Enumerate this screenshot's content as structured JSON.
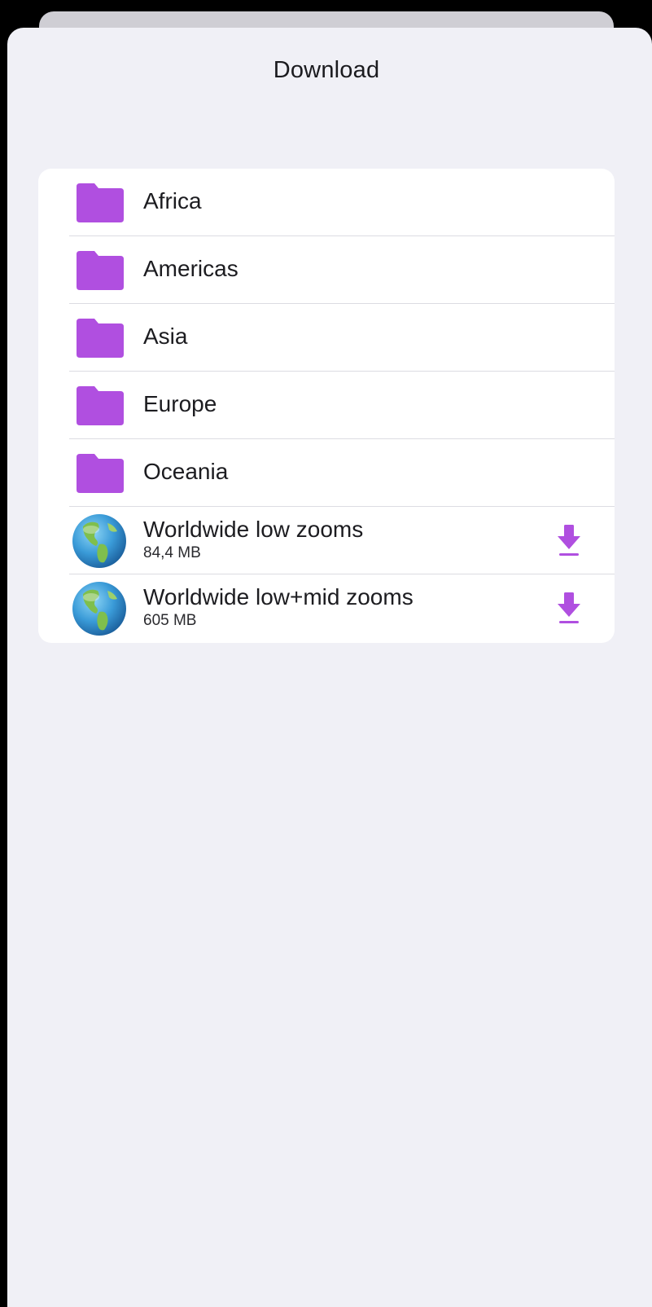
{
  "sheet": {
    "title": "Download"
  },
  "regions": [
    {
      "label": "Africa",
      "icon": "folder-icon"
    },
    {
      "label": "Americas",
      "icon": "folder-icon"
    },
    {
      "label": "Asia",
      "icon": "folder-icon"
    },
    {
      "label": "Europe",
      "icon": "folder-icon"
    },
    {
      "label": "Oceania",
      "icon": "folder-icon"
    }
  ],
  "downloads": [
    {
      "title": "Worldwide low zooms",
      "size": "84,4 MB",
      "icon": "globe-icon",
      "action_icon": "download-icon"
    },
    {
      "title": "Worldwide low+mid zooms",
      "size": "605 MB",
      "icon": "globe-icon",
      "action_icon": "download-icon"
    }
  ],
  "colors": {
    "accent": "#b04fe0",
    "sheet_background": "#f0f0f6",
    "list_background": "#ffffff"
  }
}
